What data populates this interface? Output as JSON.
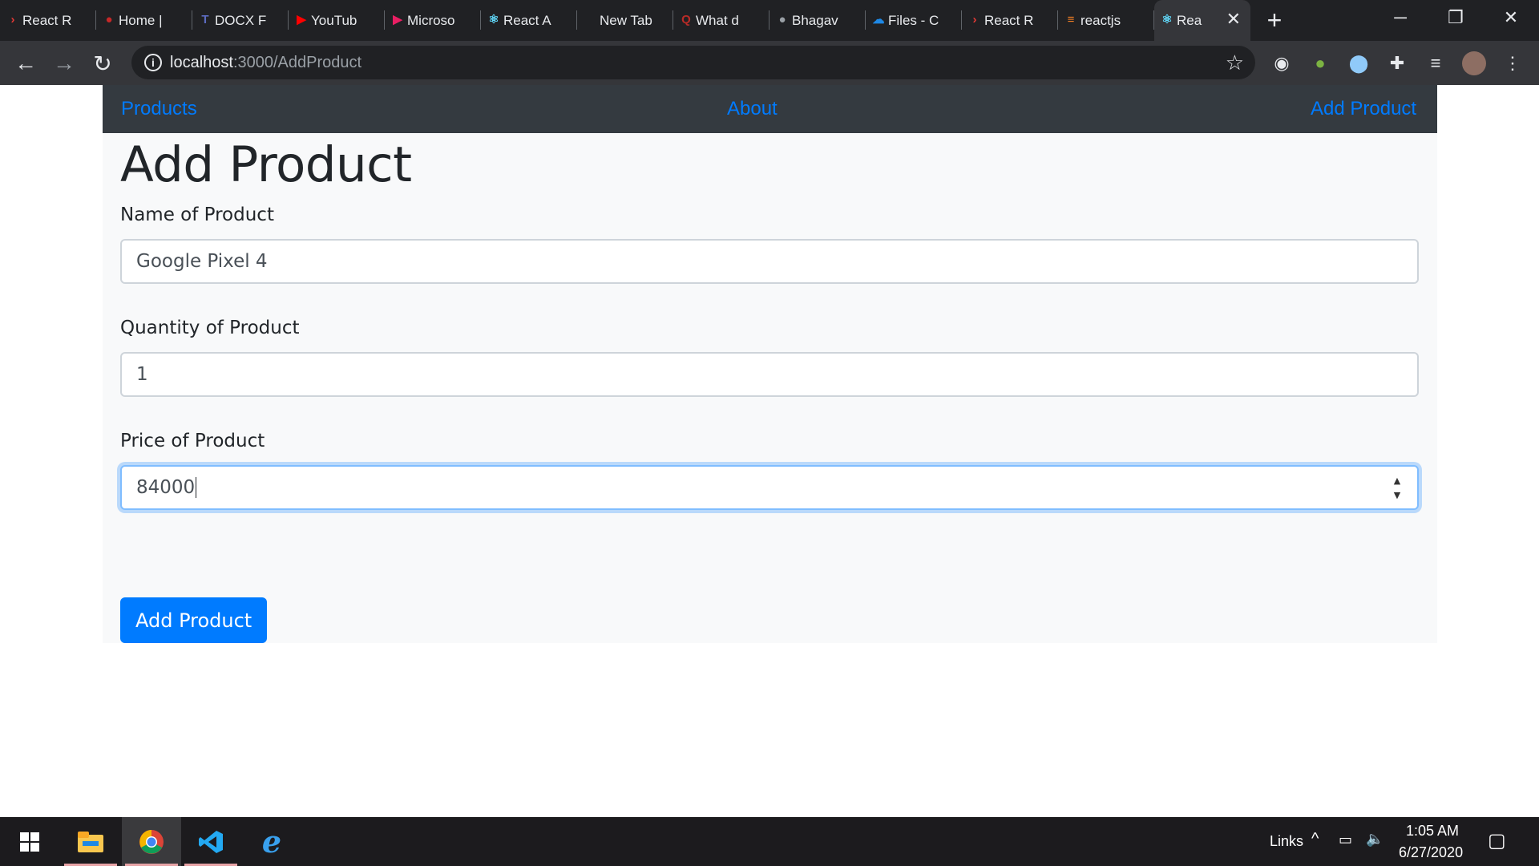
{
  "browser": {
    "tabs": [
      {
        "label": "React R",
        "icon": "chevron-right-icon",
        "color": "#e53935"
      },
      {
        "label": "Home |",
        "icon": "globe-icon",
        "color": "#c62828"
      },
      {
        "label": "DOCX F",
        "icon": "teams-icon",
        "color": "#5c6bc0"
      },
      {
        "label": "YouTub",
        "icon": "youtube-icon",
        "color": "#ff0000"
      },
      {
        "label": "Microso",
        "icon": "stream-play-icon",
        "color": "#e91e63"
      },
      {
        "label": "React A",
        "icon": "react-icon",
        "color": "#61dafb"
      },
      {
        "label": "New Tab",
        "icon": "",
        "color": ""
      },
      {
        "label": "What d",
        "icon": "quora-icon",
        "color": "#b92b27"
      },
      {
        "label": "Bhagav",
        "icon": "globe-icon",
        "color": "#9aa0a6"
      },
      {
        "label": "Files - C",
        "icon": "onedrive-icon",
        "color": "#1e88e5"
      },
      {
        "label": "React R",
        "icon": "chevron-right-icon",
        "color": "#e53935"
      },
      {
        "label": "reactjs",
        "icon": "stackoverflow-icon",
        "color": "#f48024"
      }
    ],
    "active_tab": {
      "label": "Rea",
      "icon": "react-icon",
      "color": "#61dafb"
    },
    "url_host": "localhost",
    "url_rest": ":3000/AddProduct"
  },
  "app": {
    "nav": {
      "products": "Products",
      "about": "About",
      "add_product": "Add Product"
    },
    "title": "Add Product",
    "form": {
      "name_label": "Name of Product",
      "name_value": "Google Pixel 4",
      "quantity_label": "Quantity of Product",
      "quantity_value": "1",
      "price_label": "Price of Product",
      "price_value": "84000",
      "submit": "Add Product"
    }
  },
  "taskbar": {
    "links": "Links",
    "time": "1:05 AM",
    "date": "6/27/2020"
  },
  "colors": {
    "navbar_bg": "#343a40",
    "link": "#007bff",
    "button": "#007bff",
    "container_bg": "#f8f9fa"
  }
}
